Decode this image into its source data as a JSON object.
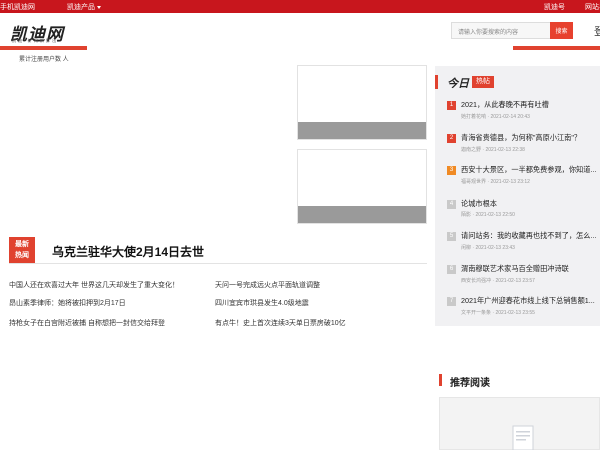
{
  "topbar": {
    "mobile_link": "手机凯迪网",
    "products_menu": "凯迪产品",
    "account_link": "凯迪号",
    "nav_link": "网站导"
  },
  "header": {
    "logo_text": "凯迪网",
    "logo_tagline": "凯 迪 · 新 闻 新 鲜 出",
    "users_count": "累计注册用户数 人",
    "search_placeholder": "请输入你要搜索的内容",
    "search_button": "搜索",
    "extra_glyph": "登"
  },
  "hot": {
    "badge_line1": "最新",
    "badge_line2": "热闻",
    "headline": "乌克兰驻华大使2月14日去世",
    "links": [
      "中国人还在欢喜过大年 世界这几天却发生了重大变化！",
      "天问一号完成远火点平面轨道调整",
      "昂山素季律师：她将被扣押到2月17日",
      "四川宜宾市珙县发生4.0级地震",
      "持枪女子在白宫附近被捕 自称想把一封信交给拜登",
      "有点牛！史上首次连续3天单日票房破10亿"
    ]
  },
  "sidebar": {
    "title": "今日",
    "tag": "热帖",
    "items": [
      {
        "num": "1",
        "title": "2021，从此春晚不再有吐槽",
        "meta": "她打着花响 · 2021-02-14 20:43"
      },
      {
        "num": "2",
        "title": "青海省贵德县，为何称\"高原小江南\"？",
        "meta": "迦南之野 · 2021-02-13 22:38"
      },
      {
        "num": "3",
        "title": "西安十大景区，一半都免费参观，你知道...",
        "meta": "福哥观世界 · 2021-02-13 23:12"
      },
      {
        "num": "4",
        "title": "论城市根本",
        "meta": "陌影 · 2021-02-13 22:50"
      },
      {
        "num": "5",
        "title": "请问站务：我的收藏再也找不到了，怎么...",
        "meta": "闲柳 · 2021-02-13 23:43"
      },
      {
        "num": "6",
        "title": "渭南穆联艺术家马百全赠田冲诗联",
        "meta": "西安长鸿强冲 · 2021-02-13 23:57"
      },
      {
        "num": "7",
        "title": "2021年广州迎春花市线上线下总销售额1...",
        "meta": "文平开一条条 · 2021-02-13 23:55"
      }
    ]
  },
  "recommended": {
    "title": "推荐阅读"
  },
  "colors": {
    "brand_red": "#c8161d",
    "accent_red": "#e0422f",
    "rank_orange": "#f08a24"
  }
}
